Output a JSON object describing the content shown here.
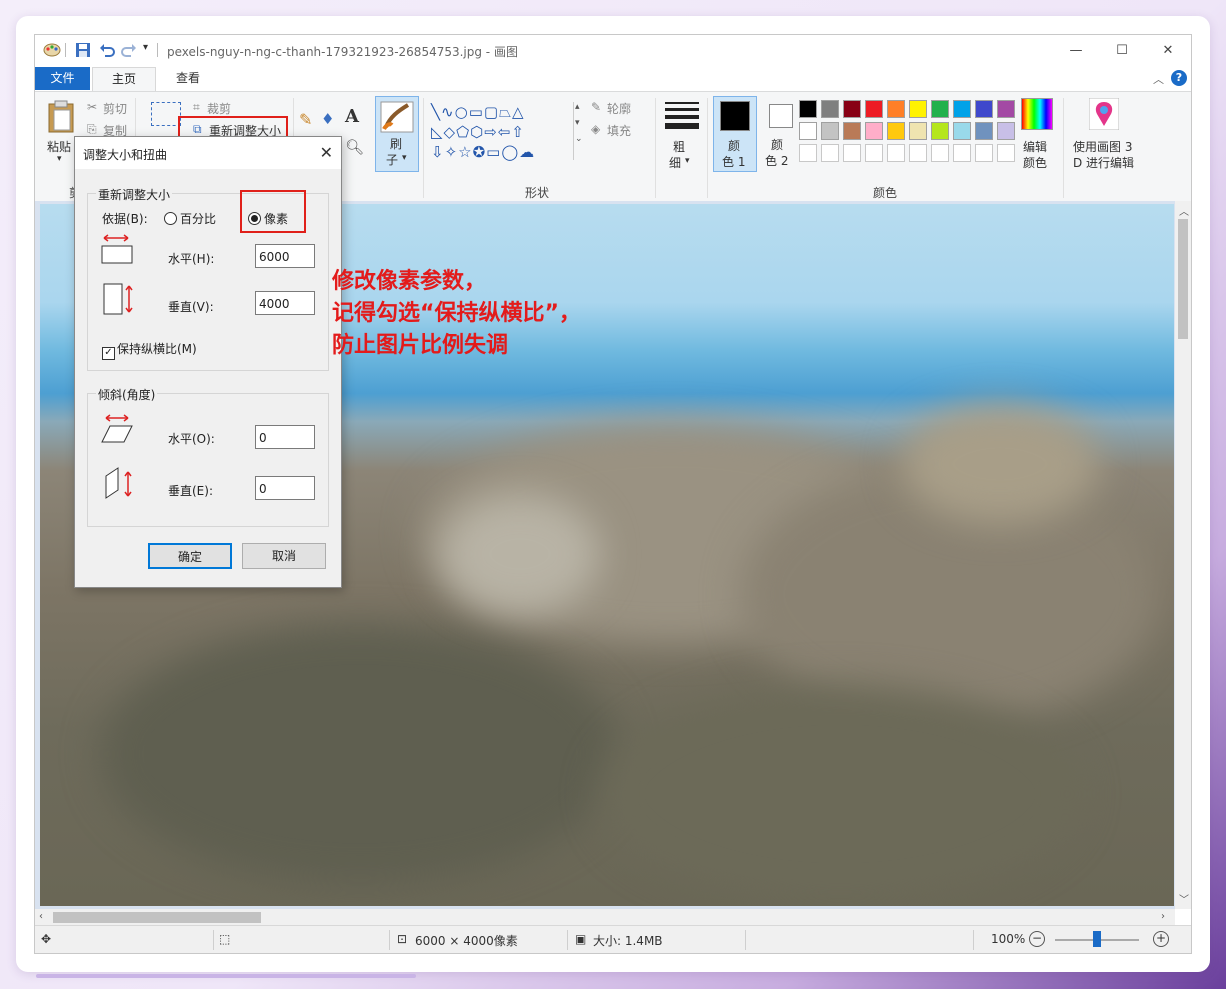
{
  "window": {
    "title": "pexels-nguy-n-ng-c-thanh-179321923-26854753.jpg - 画图",
    "minimize": "—",
    "maximize": "☐",
    "close": "✕"
  },
  "tabs": {
    "file": "文件",
    "home": "主页",
    "view": "查看"
  },
  "ribbon": {
    "clipboard": {
      "paste": "粘贴",
      "cut": "剪切",
      "copy": "复制",
      "group": "剪"
    },
    "image": {
      "crop": "裁剪",
      "resize": "重新调整大小"
    },
    "brush": {
      "line1": "刷",
      "line2": "子"
    },
    "shapes": {
      "outline": "轮廓",
      "fill": "填充",
      "group": "形状"
    },
    "size": {
      "line1": "粗",
      "line2": "细"
    },
    "color1": {
      "line1": "颜",
      "line2": "色 1"
    },
    "color2": {
      "line1": "颜",
      "line2": "色 2"
    },
    "edit_colors": {
      "line1": "编辑",
      "line2": "颜色"
    },
    "paint3d": {
      "line1": "使用画图 3",
      "line2": "D 进行编辑"
    },
    "colors_group": "颜色",
    "palette_row1": [
      "#000000",
      "#7f7f7f",
      "#880015",
      "#ed1c24",
      "#ff7f27",
      "#fff200",
      "#22b14c",
      "#00a2e8",
      "#3f48cc",
      "#a349a4"
    ],
    "palette_row2": [
      "#ffffff",
      "#c3c3c3",
      "#b97a57",
      "#ffaec9",
      "#ffc90e",
      "#efe4b0",
      "#b5e61d",
      "#99d9ea",
      "#7092be",
      "#c8bfe7"
    ]
  },
  "dialog": {
    "title": "调整大小和扭曲",
    "resize_legend": "重新调整大小",
    "by_label": "依据(B):",
    "percent": "百分比",
    "pixels": "像素",
    "horizontal_label": "水平(H):",
    "horizontal_value": "6000",
    "vertical_label": "垂直(V):",
    "vertical_value": "4000",
    "keep_ratio": "保持纵横比(M)",
    "skew_legend": "倾斜(角度)",
    "skew_h_label": "水平(O):",
    "skew_h_value": "0",
    "skew_v_label": "垂直(E):",
    "skew_v_value": "0",
    "ok": "确定",
    "cancel": "取消"
  },
  "annotation": {
    "line1": "修改像素参数，",
    "line2": "记得勾选“保持纵横比”，",
    "line3": "防止图片比例失调"
  },
  "status": {
    "dimensions": "6000 × 4000像素",
    "size": "大小: 1.4MB",
    "zoom": "100%"
  }
}
